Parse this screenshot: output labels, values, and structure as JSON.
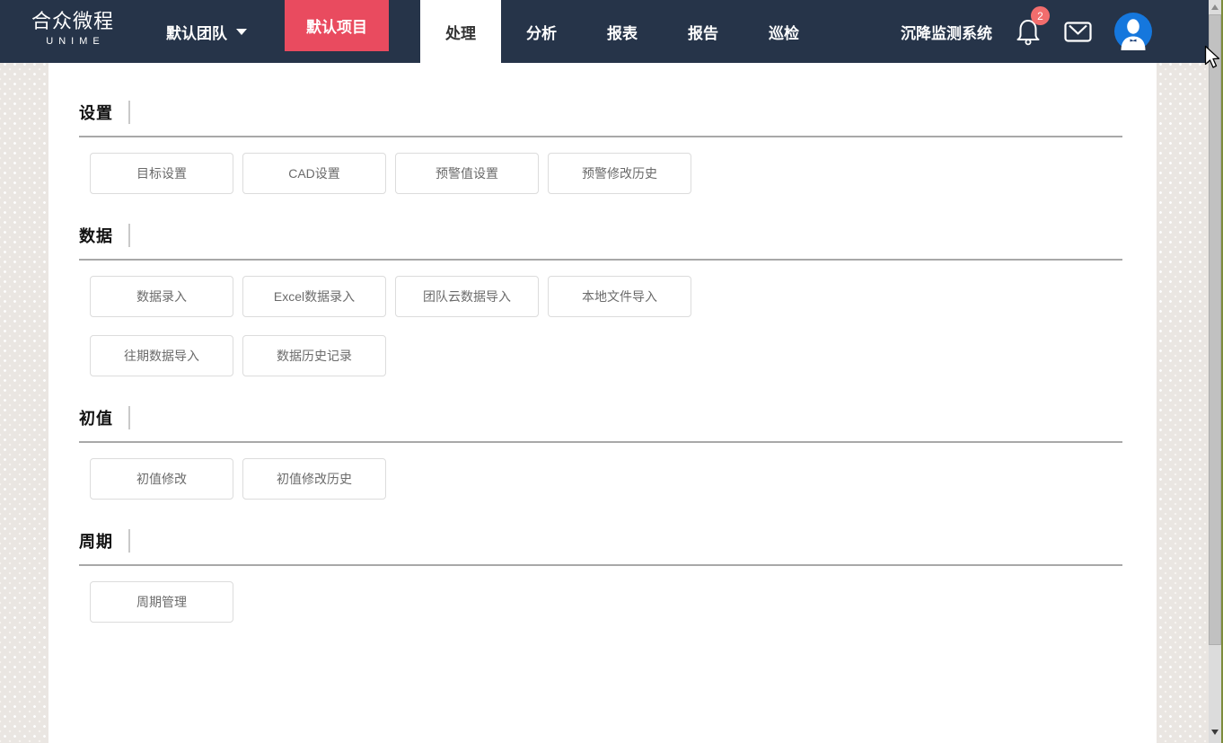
{
  "navbar": {
    "logo_title": "合众微程",
    "logo_subtitle": "UNIME",
    "team_selector": {
      "label": "默认团队"
    },
    "project_button": {
      "label": "默认项目"
    },
    "tabs": [
      {
        "label": "处理",
        "active": true
      },
      {
        "label": "分析",
        "active": false
      },
      {
        "label": "报表",
        "active": false
      },
      {
        "label": "报告",
        "active": false
      },
      {
        "label": "巡检",
        "active": false
      }
    ],
    "system_name": "沉降监测系统",
    "notifications": {
      "badge_count": "2"
    },
    "icons": [
      "bell-icon",
      "mail-icon",
      "avatar"
    ]
  },
  "colors": {
    "navbar_bg": "#263449",
    "project_button_bg": "#e94b5f",
    "badge_bg": "#f26d6d",
    "avatar_bg": "#1577dd",
    "divider": "#a8a8a8",
    "button_border": "#dcdcdc"
  },
  "sections": [
    {
      "title": "设置",
      "buttons": [
        "目标设置",
        "CAD设置",
        "预警值设置",
        "预警修改历史"
      ]
    },
    {
      "title": "数据",
      "buttons": [
        "数据录入",
        "Excel数据录入",
        "团队云数据导入",
        "本地文件导入",
        "往期数据导入",
        "数据历史记录"
      ]
    },
    {
      "title": "初值",
      "buttons": [
        "初值修改",
        "初值修改历史"
      ]
    },
    {
      "title": "周期",
      "buttons": [
        "周期管理"
      ]
    }
  ]
}
